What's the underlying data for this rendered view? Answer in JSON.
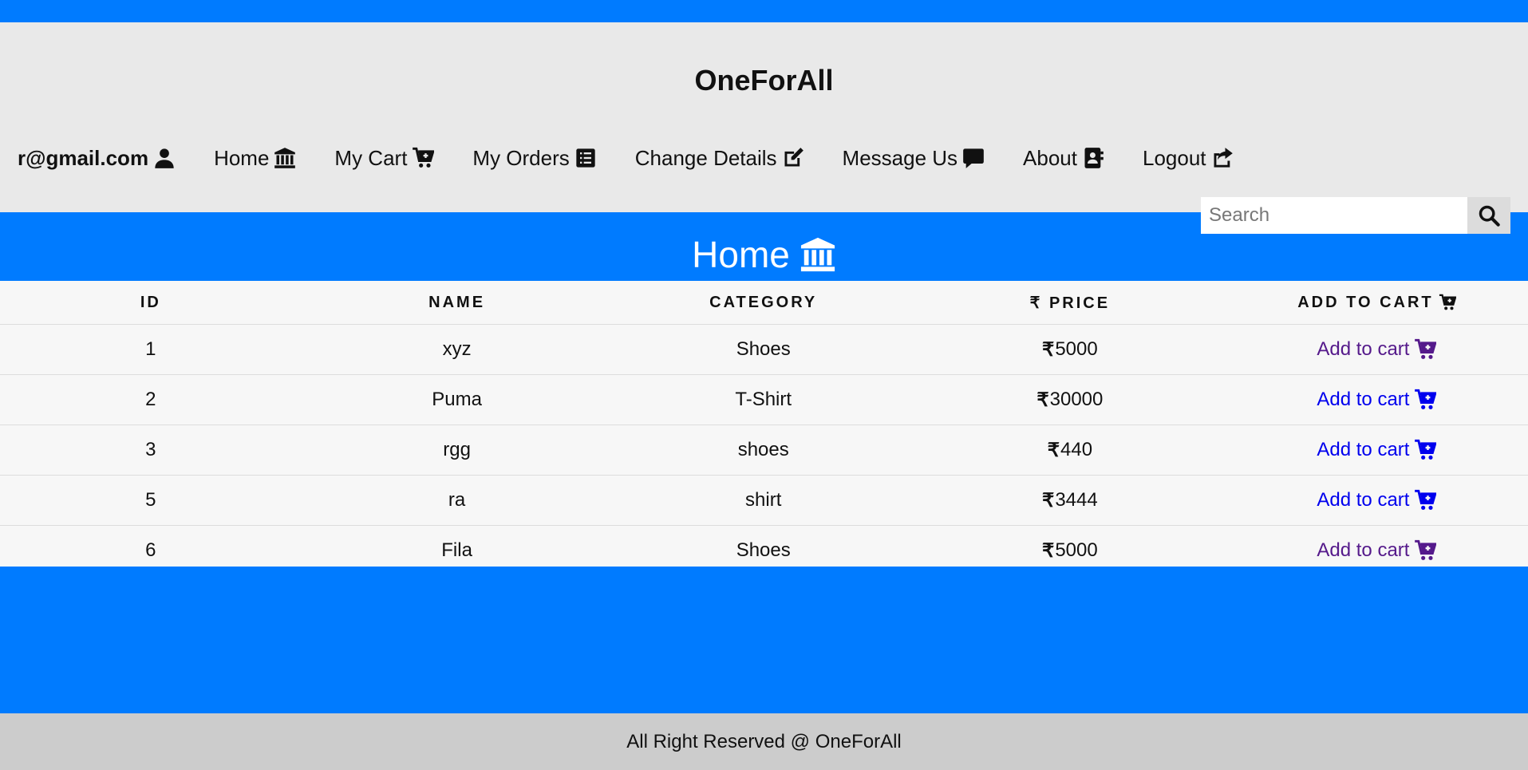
{
  "header": {
    "brand": "OneForAll"
  },
  "nav": {
    "user_email": "r@gmail.com",
    "items": [
      {
        "label": "Home",
        "icon": "bank-icon"
      },
      {
        "label": "My Cart",
        "icon": "cart-icon"
      },
      {
        "label": "My Orders",
        "icon": "list-icon"
      },
      {
        "label": "Change Details",
        "icon": "edit-icon"
      },
      {
        "label": "Message Us",
        "icon": "message-icon"
      },
      {
        "label": "About",
        "icon": "contact-book-icon"
      },
      {
        "label": "Logout",
        "icon": "share-icon"
      }
    ]
  },
  "search": {
    "placeholder": "Search",
    "value": ""
  },
  "page": {
    "title": "Home"
  },
  "table": {
    "headers": {
      "id": "ID",
      "name": "NAME",
      "category": "CATEGORY",
      "price": "₹ PRICE",
      "add_to_cart": "ADD TO CART"
    },
    "currency_symbol": "₹",
    "action_label": "Add to cart",
    "rows": [
      {
        "id": "1",
        "name": "xyz",
        "category": "Shoes",
        "price": "5000",
        "visited": true
      },
      {
        "id": "2",
        "name": "Puma",
        "category": "T-Shirt",
        "price": "30000",
        "visited": false
      },
      {
        "id": "3",
        "name": "rgg",
        "category": "shoes",
        "price": "440",
        "visited": false
      },
      {
        "id": "5",
        "name": "ra",
        "category": "shirt",
        "price": "3444",
        "visited": false
      },
      {
        "id": "6",
        "name": "Fila",
        "category": "Shoes",
        "price": "5000",
        "visited": true
      }
    ]
  },
  "colors": {
    "primary": "#007bff",
    "header_bg": "#e9e9e9",
    "footer_bg": "#cccccc",
    "link": "#0000ee",
    "link_visited": "#551a8b"
  },
  "footer": {
    "text": "All Right Reserved @ OneForAll"
  }
}
